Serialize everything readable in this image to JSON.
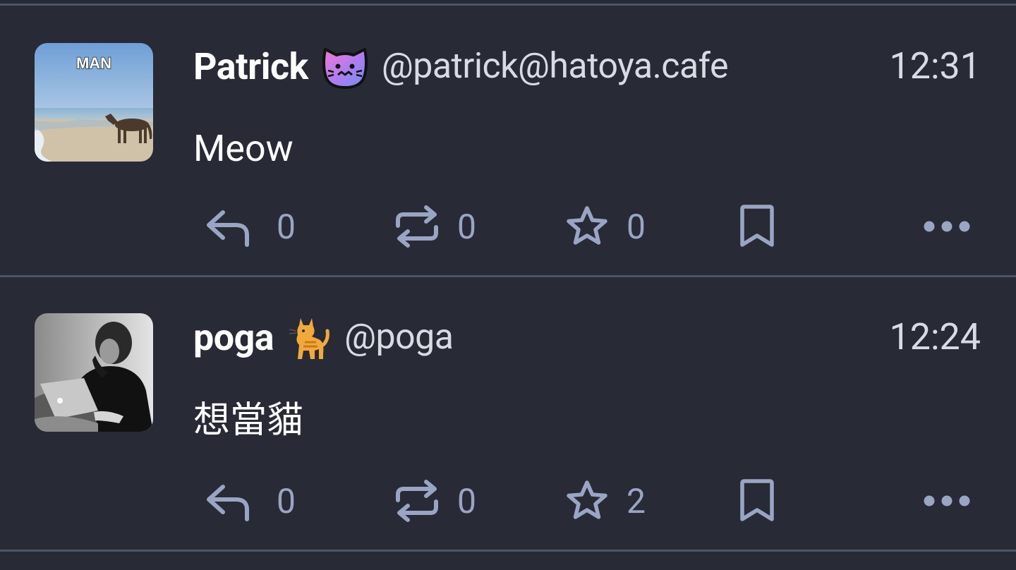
{
  "statuses": [
    {
      "display_name": "Patrick",
      "emoji_icon": "cat-face-emoji-icon",
      "handle": "@patrick@hatoya.cafe",
      "time": "12:31",
      "content": "Meow",
      "avatar_caption": "MAN",
      "avatar_icon": "horse-on-beach-avatar",
      "reply_count": "0",
      "boost_count": "0",
      "favourite_count": "0"
    },
    {
      "display_name": "poga",
      "emoji_icon": "cat-emoji-icon",
      "handle": "@poga",
      "time": "12:24",
      "content": "想當貓",
      "avatar_icon": "person-with-laptop-avatar",
      "reply_count": "0",
      "boost_count": "0",
      "favourite_count": "2"
    }
  ],
  "icons": {
    "reply": "reply-icon",
    "boost": "boost-icon",
    "favourite": "star-icon",
    "bookmark": "bookmark-icon",
    "more": "more-icon"
  },
  "colors": {
    "background": "#282a36",
    "divider": "#4d5568",
    "icon": "#9aa5c4",
    "muted_text": "#d9dbe4"
  }
}
